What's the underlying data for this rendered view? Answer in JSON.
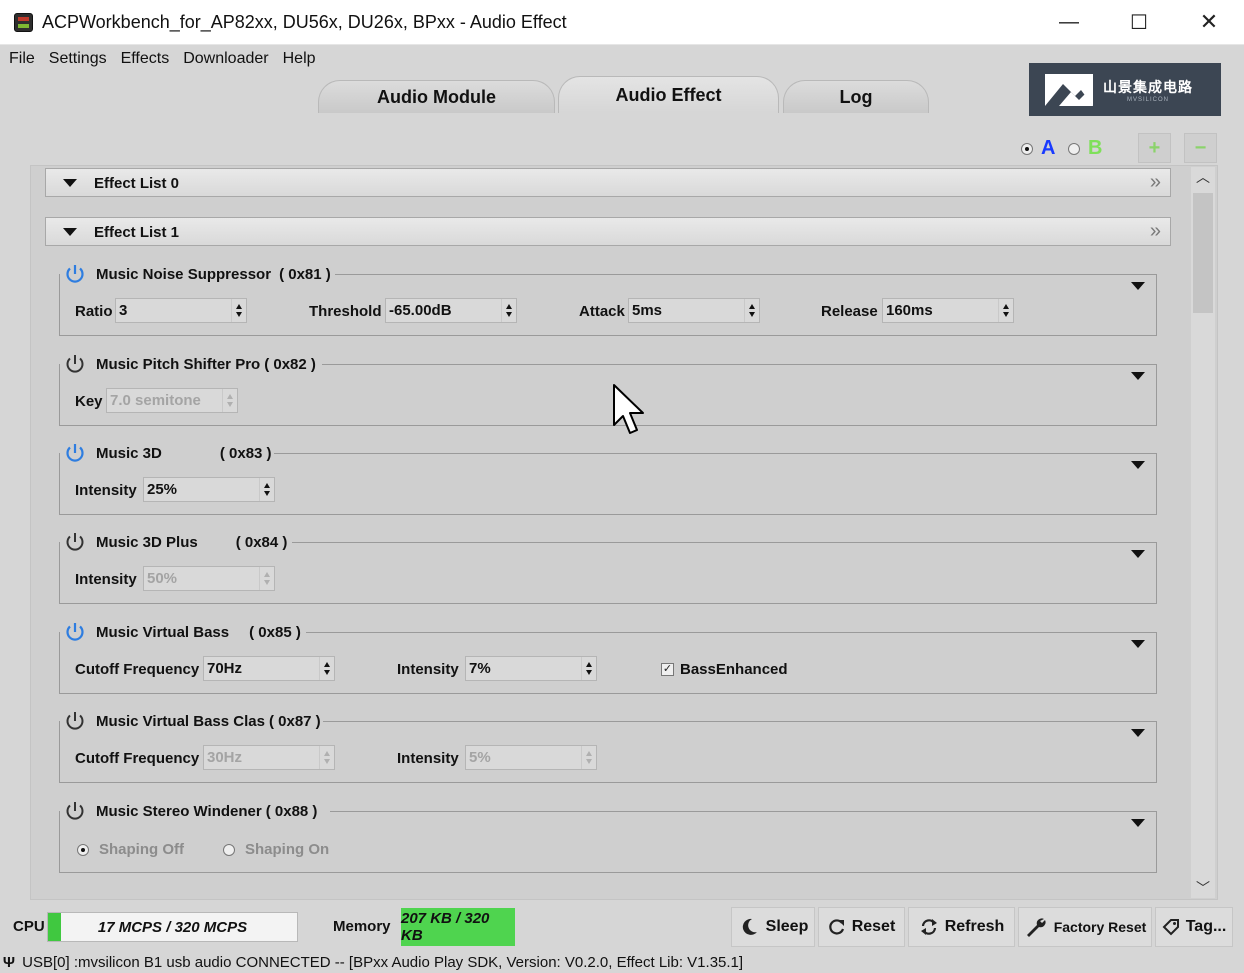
{
  "window": {
    "title": "ACPWorkbench_for_AP82xx, DU56x, DU26x, BPxx - Audio Effect",
    "min_glyph": "—",
    "max_glyph": "☐",
    "close_glyph": "✕"
  },
  "menu": [
    "File",
    "Settings",
    "Effects",
    "Downloader",
    "Help"
  ],
  "tabs": [
    {
      "label": "Audio Module",
      "active": false
    },
    {
      "label": "Audio Effect",
      "active": true
    },
    {
      "label": "Log",
      "active": false
    }
  ],
  "logo": {
    "text_cn": "山景集成电路",
    "text_en": "MVSILICON"
  },
  "ab": {
    "a": "A",
    "b": "B",
    "selected": "A",
    "a_color": "#1a3bff",
    "b_color": "#7fe05a"
  },
  "pm": {
    "plus": "+",
    "minus": "−"
  },
  "lists": [
    {
      "title": "Effect List 0",
      "chev": "»"
    },
    {
      "title": "Effect List 1",
      "chev": "»"
    }
  ],
  "effects": [
    {
      "name": "Music Noise Suppressor",
      "code": "( 0x81 )",
      "enabled": true,
      "fields": [
        {
          "label": "Ratio",
          "value": "3"
        },
        {
          "label": "Threshold",
          "value": "-65.00dB"
        },
        {
          "label": "Attack",
          "value": "5ms"
        },
        {
          "label": "Release",
          "value": "160ms"
        }
      ]
    },
    {
      "name": "Music Pitch Shifter Pro",
      "code": "( 0x82 )",
      "enabled": false,
      "fields": [
        {
          "label": "Key",
          "value": "7.0 semitone"
        }
      ]
    },
    {
      "name": "Music 3D",
      "code": "( 0x83 )",
      "enabled": true,
      "fields": [
        {
          "label": "Intensity",
          "value": "25%"
        }
      ]
    },
    {
      "name": "Music 3D Plus",
      "code": "( 0x84 )",
      "enabled": false,
      "fields": [
        {
          "label": "Intensity",
          "value": "50%"
        }
      ]
    },
    {
      "name": "Music Virtual Bass",
      "code": "( 0x85 )",
      "enabled": true,
      "fields": [
        {
          "label": "Cutoff Frequency",
          "value": "70Hz"
        },
        {
          "label": "Intensity",
          "value": "7%"
        }
      ],
      "checkbox": {
        "label": "BassEnhanced",
        "checked": true
      }
    },
    {
      "name": "Music Virtual Bass Clas",
      "code": "( 0x87 )",
      "enabled": false,
      "fields": [
        {
          "label": "Cutoff Frequency",
          "value": "30Hz"
        },
        {
          "label": "Intensity",
          "value": "5%"
        }
      ]
    },
    {
      "name": "Music Stereo Windener",
      "code": "( 0x88 )",
      "enabled": false,
      "radios": [
        {
          "label": "Shaping Off",
          "checked": true
        },
        {
          "label": "Shaping On",
          "checked": false
        }
      ]
    }
  ],
  "status": {
    "cpu_label": "CPU",
    "cpu_text": "17 MCPS / 320 MCPS",
    "cpu_fraction": 0.053,
    "mem_label": "Memory",
    "mem_text": "207 KB / 320 KB",
    "buttons": {
      "sleep": "Sleep",
      "reset": "Reset",
      "refresh": "Refresh",
      "factory_reset": "Factory Reset",
      "tag": "Tag..."
    },
    "usb_icon": "Ψ",
    "connection": "USB[0] :mvsilicon B1 usb audio CONNECTED -- [BPxx Audio Play SDK,  Version: V0.2.0,  Effect Lib: V1.35.1]"
  },
  "colors": {
    "power_on": "#2e7de0",
    "power_off": "#333333",
    "cpu_fill": "#40c840",
    "mem_fill": "#4fd44f"
  }
}
